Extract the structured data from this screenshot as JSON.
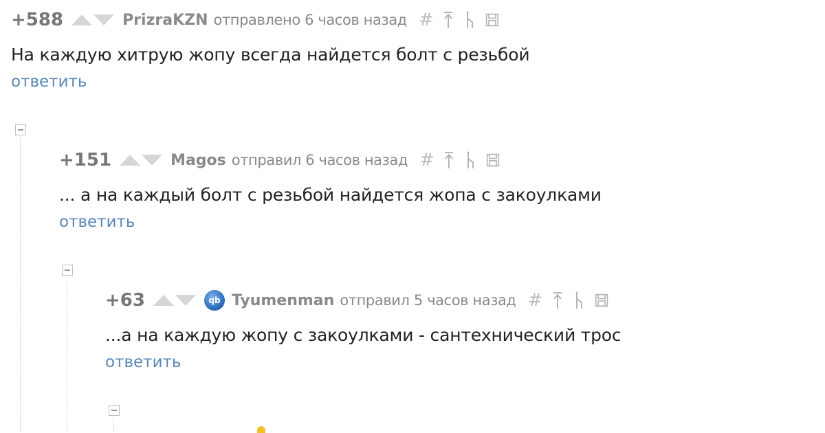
{
  "comments": [
    {
      "rating": "+588",
      "author": "PrizraKZN",
      "posted": "отправлено 6 часов назад",
      "text": "На каждую хитрую жопу всегда найдется болт с резьбой",
      "reply_label": "ответить"
    },
    {
      "rating": "+151",
      "author": "Magos",
      "posted": "отправил 6 часов назад",
      "text": "... а на каждый болт с резьбой найдется жопа с закоулками",
      "reply_label": "ответить"
    },
    {
      "rating": "+63",
      "author": "Tyumenman",
      "posted": "отправил 5 часов назад",
      "text": "...а на каждую жопу с закоулками - сантехнический трос",
      "reply_label": "ответить",
      "avatar_label": "qb"
    }
  ],
  "tool_icons": [
    "hash-icon",
    "scroll-to-parent-icon",
    "branch-icon",
    "save-icon"
  ],
  "colors": {
    "rating": "#777777",
    "vote_arrow": "#d6d6d6",
    "author": "#8a8a8a",
    "reply_link": "#5a87b8",
    "text": "#222222"
  }
}
